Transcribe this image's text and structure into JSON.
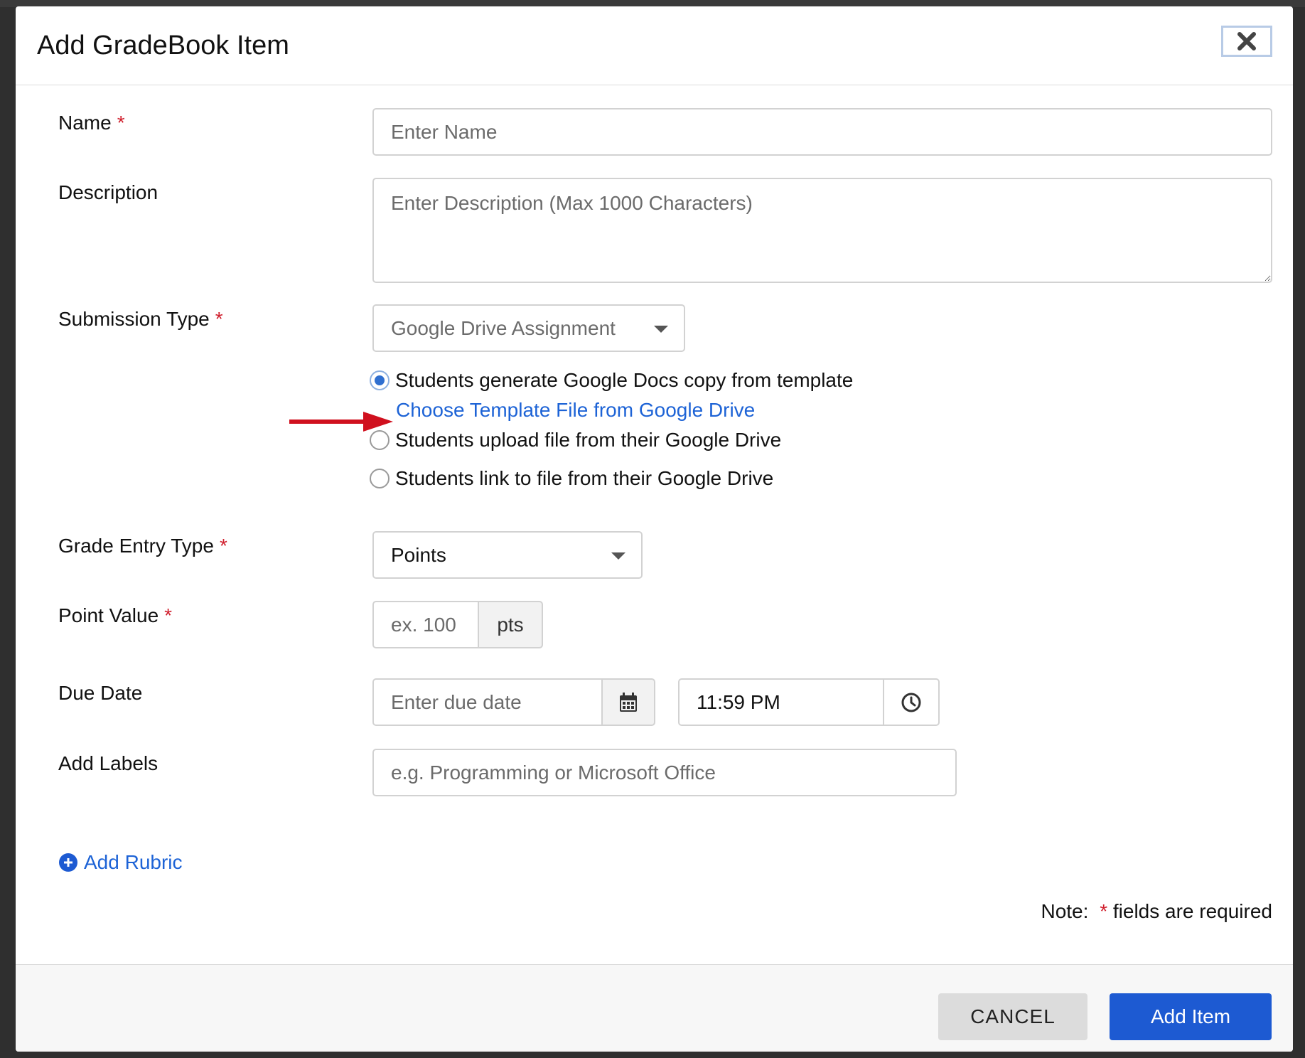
{
  "modal": {
    "title": "Add GradeBook Item",
    "close_icon": "close-icon"
  },
  "form": {
    "name": {
      "label": "Name",
      "required_mark": "*",
      "placeholder": "Enter Name"
    },
    "description": {
      "label": "Description",
      "placeholder": "Enter Description (Max 1000 Characters)"
    },
    "submission_type": {
      "label": "Submission Type",
      "required_mark": "*",
      "selected": "Google Drive Assignment",
      "options": [
        {
          "label": "Students generate Google Docs copy from template",
          "checked": true
        },
        {
          "label": "Students upload file from their Google Drive",
          "checked": false
        },
        {
          "label": "Students link to file from their Google Drive",
          "checked": false
        }
      ],
      "template_link": "Choose Template File from Google Drive"
    },
    "grade_entry_type": {
      "label": "Grade Entry Type",
      "required_mark": "*",
      "selected": "Points"
    },
    "point_value": {
      "label": "Point Value",
      "required_mark": "*",
      "placeholder": "ex. 100",
      "unit": "pts"
    },
    "due_date": {
      "label": "Due Date",
      "placeholder": "Enter due date",
      "time": "11:59 PM",
      "calendar_icon": "calendar-icon",
      "clock_icon": "clock-icon"
    },
    "labels": {
      "label": "Add Labels",
      "placeholder": "e.g. Programming or Microsoft Office"
    },
    "add_rubric": "Add Rubric",
    "note": {
      "prefix": "Note:",
      "mark": "*",
      "suffix": "fields are required"
    }
  },
  "footer": {
    "cancel_label": "CANCEL",
    "add_label": "Add Item"
  },
  "colors": {
    "accent": "#1d5ad2",
    "required": "#d0202e",
    "link": "#1d63d6",
    "annotation_arrow": "#d0101e"
  }
}
